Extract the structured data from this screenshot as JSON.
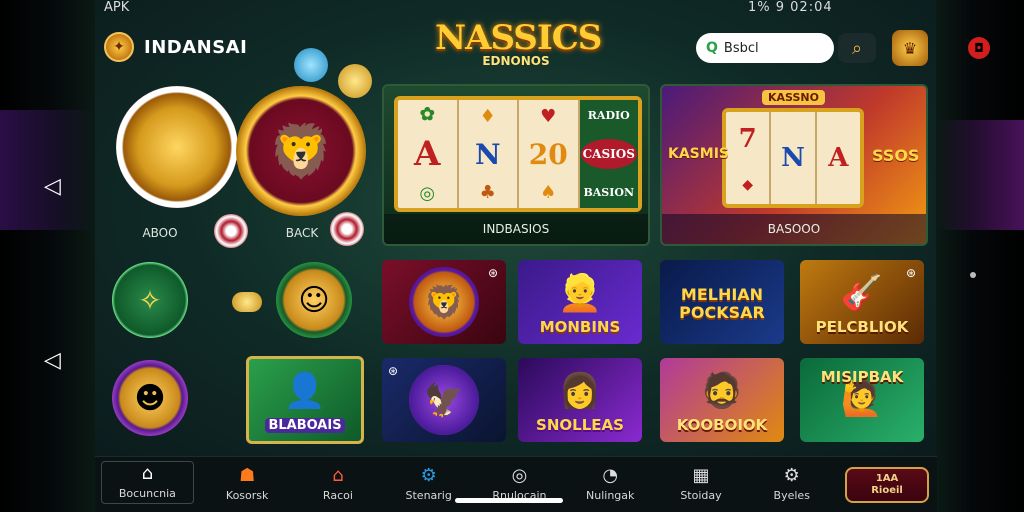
{
  "status_bar": {
    "left": "APK",
    "right": "1%  9 02:04"
  },
  "header": {
    "brand": "INDANSAI",
    "logo_title": "NASSICS",
    "logo_sub": "EDNONOS",
    "search_value": "Bsbcl"
  },
  "featured": {
    "chip_left_label": "ABOO",
    "chip_right_label": "BACK",
    "slot1": {
      "caption": "INDBASIOS",
      "side_top": "RADIO",
      "side_mid": "CASIOS",
      "side_bot": "BASION"
    },
    "slot2": {
      "caption": "BASOOO",
      "top": "KASSNO",
      "left": "KASMIS",
      "right": "SSOS"
    }
  },
  "games": [
    {
      "title": "",
      "color": "#6a0a20"
    },
    {
      "title": "MONBINS",
      "color": "#5a2aa0"
    },
    {
      "title": "MELHIAN POCKSAR",
      "color": "#102a6a"
    },
    {
      "title": "PELCBLIOK",
      "color": "#b06a10"
    },
    {
      "title": "",
      "color": "#1a2a6a"
    },
    {
      "title": "SNOLLEAS",
      "color": "#3a1a6a"
    },
    {
      "title": "KOOBOIOK",
      "color": "#b04a10"
    },
    {
      "title": "MISIPBAK",
      "color": "#0f6a3a"
    }
  ],
  "side_games": {
    "left_card": "BLABOAIS"
  },
  "bottom_nav": [
    {
      "label": "Bocuncnia",
      "icon": "home-icon"
    },
    {
      "label": "Kosorsk",
      "icon": "ghost-icon"
    },
    {
      "label": "Racoi",
      "icon": "shop-icon"
    },
    {
      "label": "Stenarig",
      "icon": "gear-icon"
    },
    {
      "label": "Rnulocain",
      "icon": "circle-icon"
    },
    {
      "label": "Nulingak",
      "icon": "clock-icon"
    },
    {
      "label": "Stoiday",
      "icon": "calendar-icon"
    },
    {
      "label": "Byeles",
      "icon": "settings-icon"
    }
  ],
  "promo_button": {
    "line1": "1AA",
    "line2": "Rioeil"
  }
}
